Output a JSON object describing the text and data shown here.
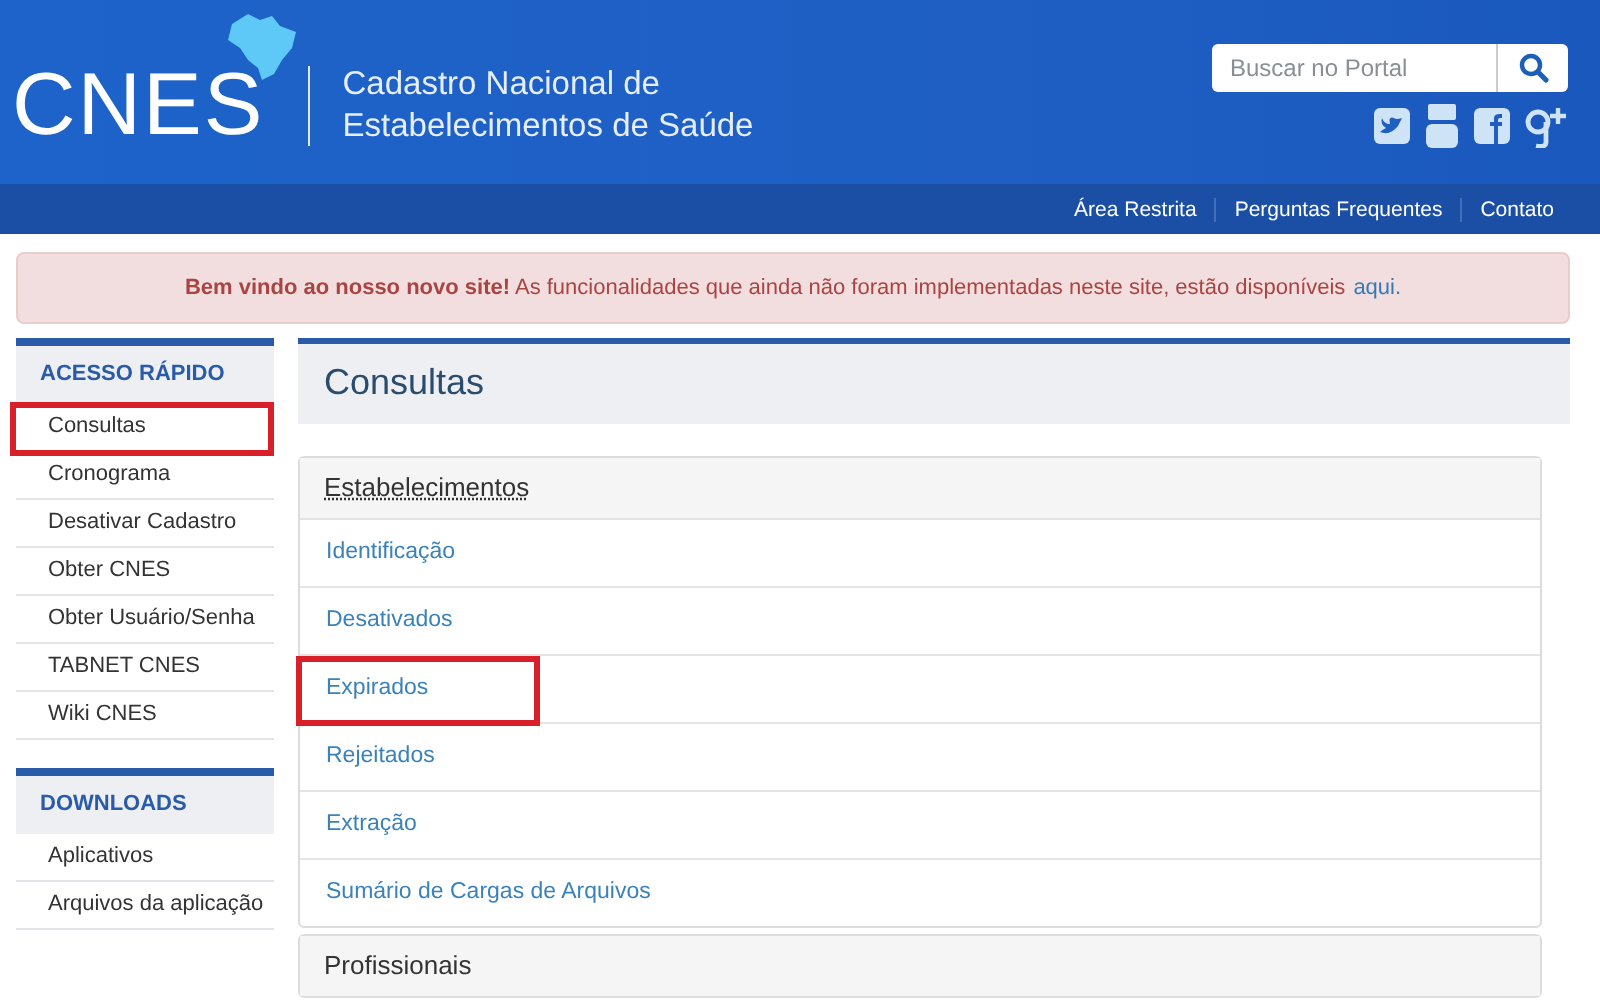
{
  "header": {
    "logo": "CNES",
    "title_lines": [
      "Cadastro Nacional de",
      "Estabelecimentos de Saúde"
    ],
    "search": {
      "placeholder": "Buscar no Portal"
    }
  },
  "nav": [
    "Área Restrita",
    "Perguntas Frequentes",
    "Contato"
  ],
  "alert": {
    "text": "**Bem vindo ao nosso novo site!** As funcionalidades que ainda não foram implementadas neste site, estão disponíveis",
    "link": "aqui."
  },
  "sidebar": [
    {
      "title": "ACESSO RÁPIDO",
      "items": [
        {
          "label": "Consultas",
          "highlighted": true
        },
        {
          "label": "Cronograma",
          "highlighted": false
        },
        {
          "label": "Desativar Cadastro",
          "highlighted": false
        },
        {
          "label": "Obter CNES",
          "highlighted": false
        },
        {
          "label": "Obter Usuário/Senha",
          "highlighted": false
        },
        {
          "label": "TABNET CNES",
          "highlighted": false
        },
        {
          "label": "Wiki CNES",
          "highlighted": false
        }
      ]
    },
    {
      "title": "DOWNLOADS",
      "items": [
        {
          "label": "Aplicativos",
          "highlighted": false
        },
        {
          "label": "Arquivos da aplicação",
          "highlighted": false
        }
      ]
    }
  ],
  "main": {
    "title": "Consultas",
    "panels": [
      {
        "title": "Estabelecimentos",
        "expanded": true,
        "items": [
          {
            "label": "Identificação",
            "highlighted": false
          },
          {
            "label": "Desativados",
            "highlighted": false
          },
          {
            "label": "Expirados",
            "highlighted": true
          },
          {
            "label": "Rejeitados",
            "highlighted": false
          },
          {
            "label": "Extração",
            "highlighted": false
          },
          {
            "label": "Sumário de Cargas de Arquivos",
            "highlighted": false
          }
        ]
      },
      {
        "title": "Profissionais",
        "expanded": false
      }
    ]
  }
}
